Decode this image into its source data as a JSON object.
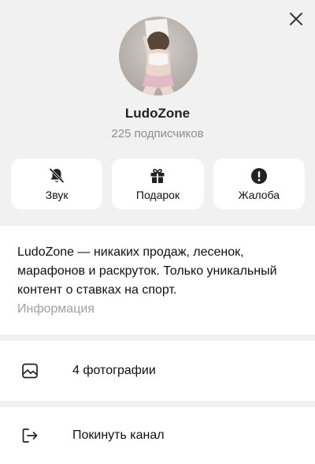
{
  "channel": {
    "name": "LudoZone",
    "subscribers": "225 подписчиков",
    "description": "LudoZone — никаких продаж, лесенок, марафонов и раскруток. Только уникальный контент о ставках на спорт.",
    "info_caption": "Информация"
  },
  "actions": [
    {
      "label": "Звук",
      "icon": "bell-off-icon"
    },
    {
      "label": "Подарок",
      "icon": "gift-icon"
    },
    {
      "label": "Жалоба",
      "icon": "alert-icon"
    }
  ],
  "rows": {
    "photos": {
      "label": "4 фотографии",
      "icon": "image-icon"
    },
    "leave": {
      "label": "Покинуть канал",
      "icon": "exit-icon"
    }
  },
  "colors": {
    "background": "#f1f1f1",
    "card": "#ffffff",
    "muted_text": "#8e8e8e"
  }
}
